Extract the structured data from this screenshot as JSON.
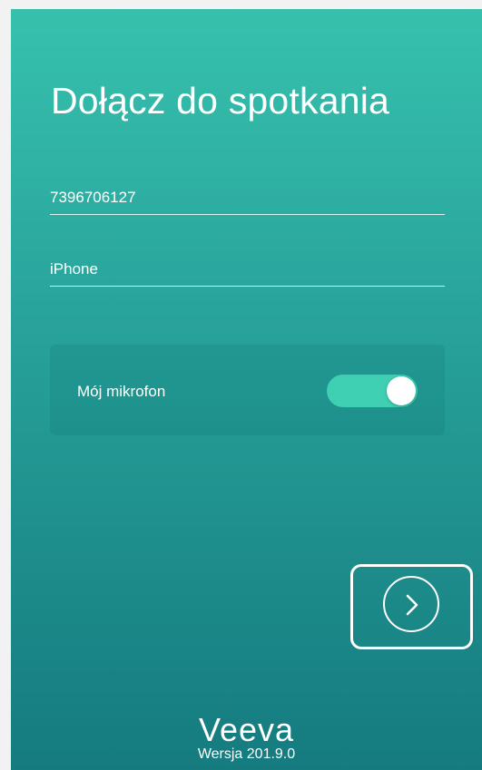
{
  "screen": {
    "title": "Dołącz do spotkania",
    "meeting_id": "7396706127",
    "device_name": "iPhone",
    "mic_label": "Mój mikrofon",
    "mic_enabled": true,
    "next_icon": "chevron-right-icon",
    "logo_text": "Veeva",
    "version": "Wersja 201.9.0"
  },
  "colors": {
    "gradient_top": "#37c1ad",
    "gradient_bottom": "#157b7f",
    "toggle_on": "#3fcfb3",
    "text": "#ffffff"
  }
}
